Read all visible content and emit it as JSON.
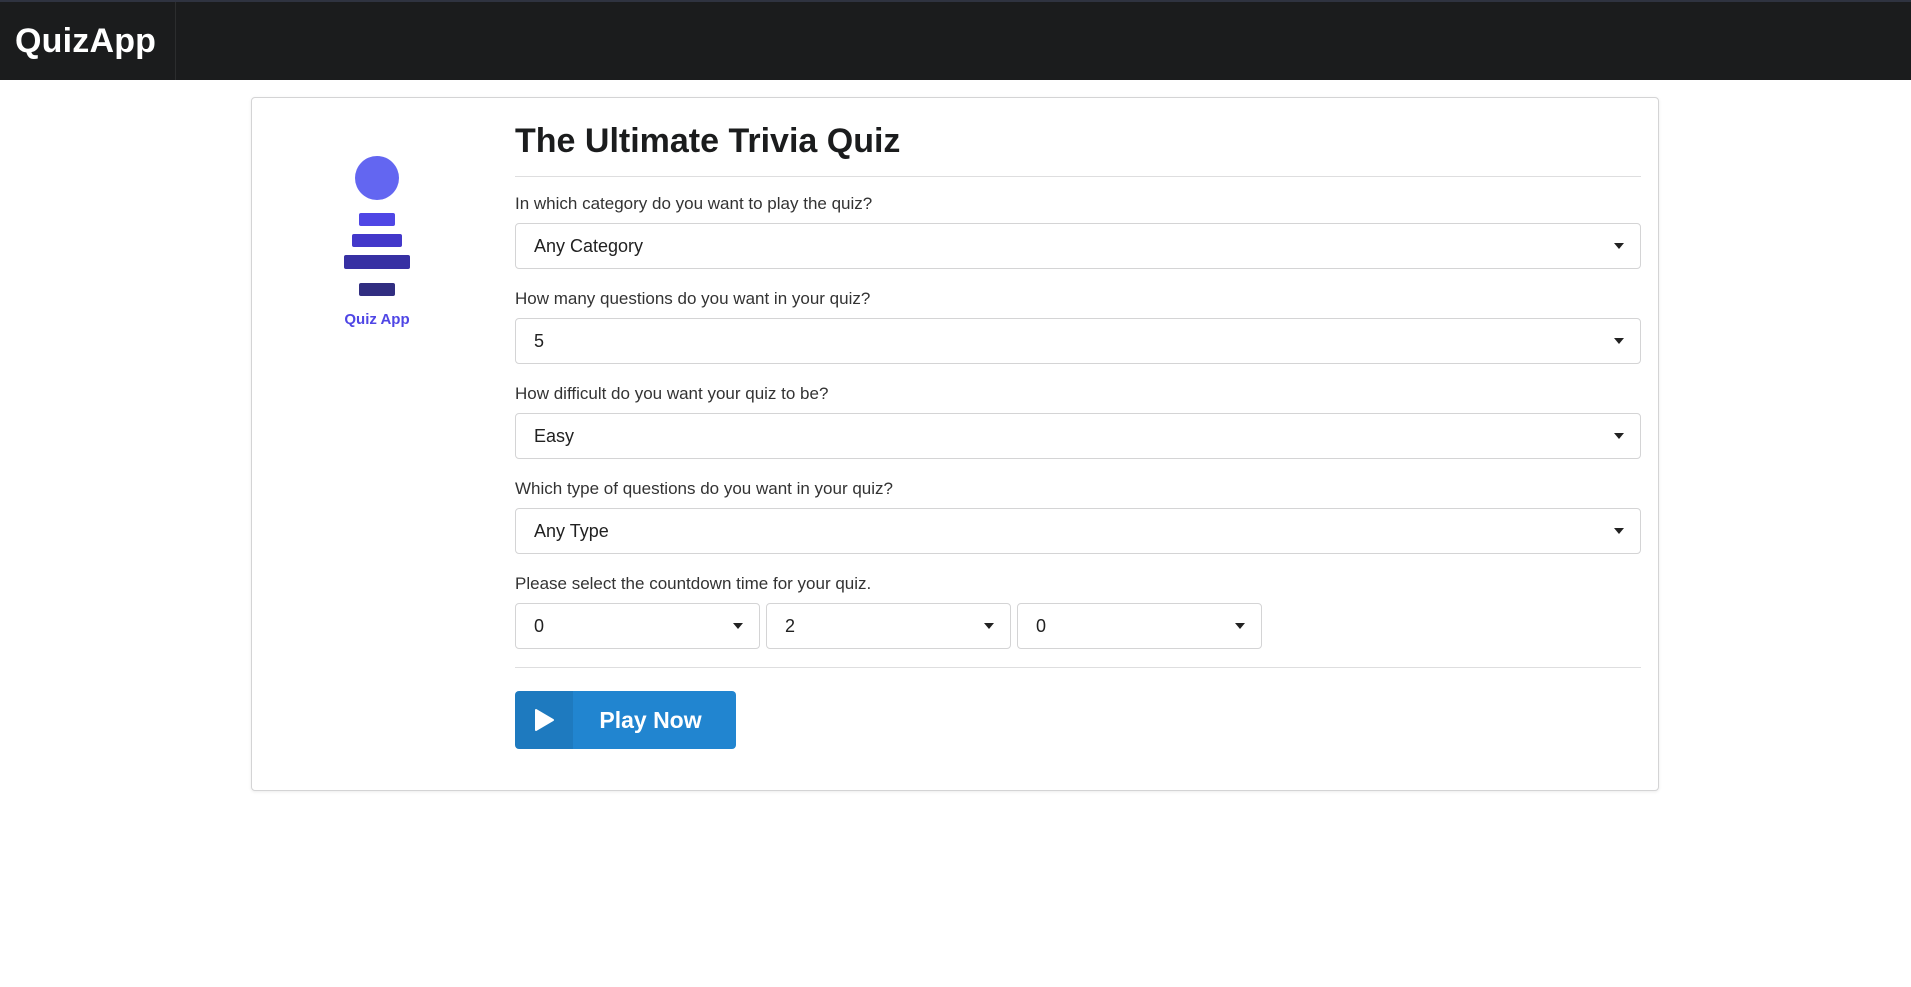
{
  "app": {
    "brand": "QuizApp"
  },
  "logo": {
    "caption": "Quiz App"
  },
  "form": {
    "title": "The Ultimate Trivia Quiz",
    "category": {
      "label": "In which category do you want to play the quiz?",
      "value": "Any Category"
    },
    "questions": {
      "label": "How many questions do you want in your quiz?",
      "value": "5"
    },
    "difficulty": {
      "label": "How difficult do you want your quiz to be?",
      "value": "Easy"
    },
    "type": {
      "label": "Which type of questions do you want in your quiz?",
      "value": "Any Type"
    },
    "countdown": {
      "label": "Please select the countdown time for your quiz.",
      "hours": "0",
      "minutes": "2",
      "seconds": "0"
    },
    "play_button": "Play Now"
  },
  "icons": {
    "dropdown": "chevron-down-icon",
    "play": "play-icon"
  },
  "colors": {
    "topbar": "#1b1c1d",
    "primary_button": "#2185d0",
    "logo_accent": "#4f46e5"
  }
}
